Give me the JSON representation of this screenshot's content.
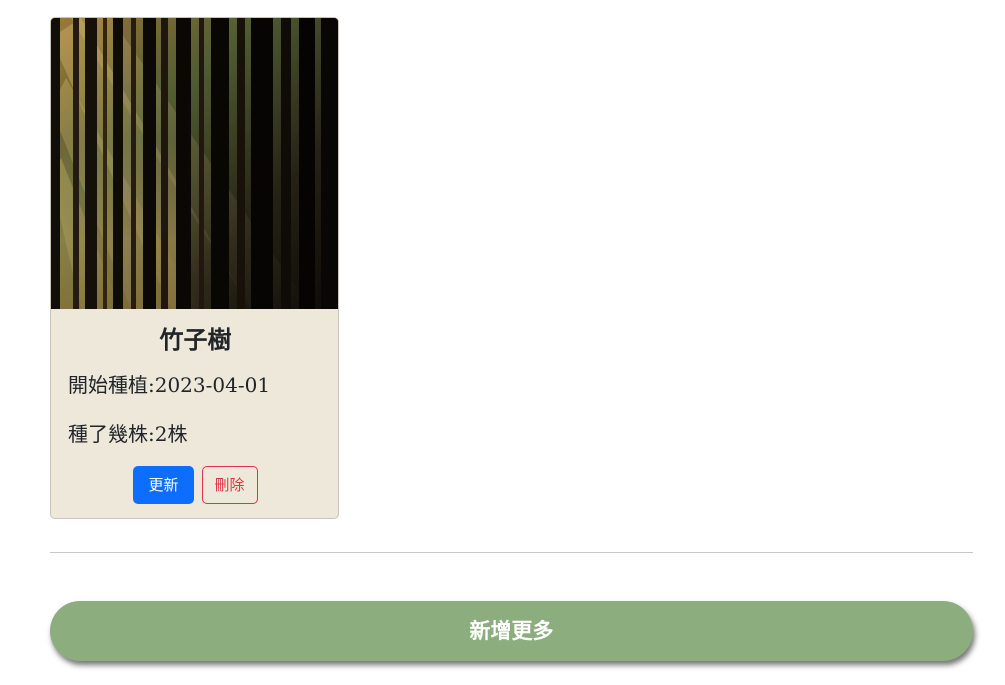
{
  "card": {
    "image": "forest-sunbeams-photo",
    "title": "竹子樹",
    "start_date_text": "開始種植:2023-04-01",
    "plant_count_text": "種了幾株:2株",
    "update_label": "更新",
    "delete_label": "刪除"
  },
  "add_more_label": "新增更多",
  "colors": {
    "card_background": "#ede8da",
    "update_button": "#0d6efd",
    "delete_button": "#dc3545",
    "add_more_button": "#8cae7f"
  }
}
